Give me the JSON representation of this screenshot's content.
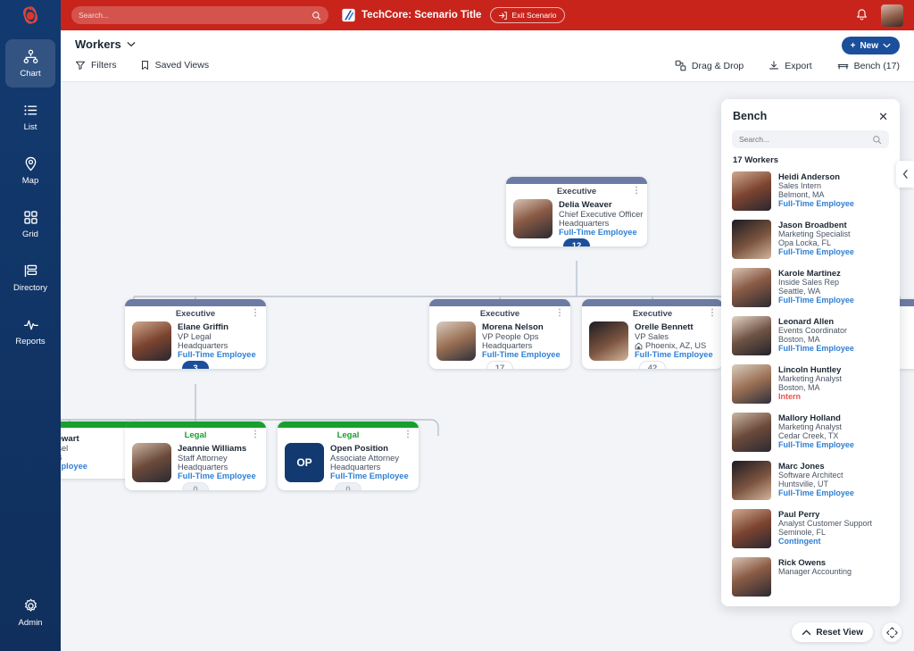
{
  "topbar": {
    "search_placeholder": "Search...",
    "scenario_title": "TechCore: Scenario Title",
    "exit_label": "Exit Scenario",
    "brand_color": "#c8241c"
  },
  "sidebar": {
    "items": [
      {
        "label": "Chart",
        "icon": "org-chart-icon",
        "active": true
      },
      {
        "label": "List",
        "icon": "list-icon",
        "active": false
      },
      {
        "label": "Map",
        "icon": "map-pin-icon",
        "active": false
      },
      {
        "label": "Grid",
        "icon": "grid-icon",
        "active": false
      },
      {
        "label": "Directory",
        "icon": "directory-icon",
        "active": false
      },
      {
        "label": "Reports",
        "icon": "pulse-icon",
        "active": false
      }
    ],
    "admin": {
      "label": "Admin",
      "icon": "gear-icon"
    }
  },
  "toolbar": {
    "title": "Workers",
    "filters_label": "Filters",
    "saved_views_label": "Saved Views",
    "drag_drop_label": "Drag & Drop",
    "export_label": "Export",
    "bench_label": "Bench (17)",
    "new_label": "New"
  },
  "chart": {
    "nodes": [
      {
        "name": "Delia Weaver",
        "role": "Chief Executive Officer",
        "location": "Headquarters",
        "type": "Full-Time Employee",
        "department": "Executive",
        "badge": "12",
        "badge_style": "blue",
        "has_home_icon": false,
        "avatar": "photo"
      },
      {
        "name": "Elane Griffin",
        "role": "VP Legal",
        "location": "Headquarters",
        "type": "Full-Time Employee",
        "department": "Executive",
        "badge": "3",
        "badge_style": "blue",
        "has_home_icon": false,
        "avatar": "photo"
      },
      {
        "name": "Morena Nelson",
        "role": "VP People Ops",
        "location": "Headquarters",
        "type": "Full-Time Employee",
        "department": "Executive",
        "badge": "17",
        "badge_style": "plain",
        "has_home_icon": false,
        "avatar": "photo"
      },
      {
        "name": "Orelle Bennett",
        "role": "VP Sales",
        "location": "Phoenix, AZ, US",
        "type": "Full-Time Employee",
        "department": "Executive",
        "badge": "42",
        "badge_style": "plain",
        "has_home_icon": true,
        "avatar": "photo"
      },
      {
        "name": "Stewart",
        "role": "unsel",
        "location": "ters",
        "type": "Employee",
        "department": "Legal",
        "badge": "",
        "badge_style": "none",
        "has_home_icon": false,
        "avatar": "none"
      },
      {
        "name": "Jeannie Williams",
        "role": "Staff Attorney",
        "location": "Headquarters",
        "type": "Full-Time Employee",
        "department": "Legal",
        "badge": "0",
        "badge_style": "zero",
        "has_home_icon": false,
        "avatar": "photo"
      },
      {
        "name": "Open Position",
        "role": "Associate Attorney",
        "location": "Headquarters",
        "type": "Full-Time Employee",
        "department": "Legal",
        "badge": "0",
        "badge_style": "zero",
        "has_home_icon": false,
        "avatar": "OP"
      }
    ]
  },
  "bench": {
    "title": "Bench",
    "search_placeholder": "Search...",
    "count_label": "17 Workers",
    "workers": [
      {
        "name": "Heidi Anderson",
        "role": "Sales Intern",
        "location": "Belmont, MA",
        "type": "Full-Time Employee"
      },
      {
        "name": "Jason Broadbent",
        "role": "Marketing Specialist",
        "location": "Opa Locka, FL",
        "type": "Full-Time Employee"
      },
      {
        "name": "Karole Martinez",
        "role": "Inside Sales Rep",
        "location": "Seattle, WA",
        "type": "Full-Time Employee"
      },
      {
        "name": "Leonard Allen",
        "role": "Events Coordinator",
        "location": "Boston, MA",
        "type": "Full-Time Employee"
      },
      {
        "name": "Lincoln Huntley",
        "role": "Marketing Analyst",
        "location": "Boston, MA",
        "type": "Intern"
      },
      {
        "name": "Mallory Holland",
        "role": "Marketing Analyst",
        "location": "Cedar Creek, TX",
        "type": "Full-Time Employee"
      },
      {
        "name": "Marc Jones",
        "role": "Software Architect",
        "location": "Huntsville, UT",
        "type": "Full-Time Employee"
      },
      {
        "name": "Paul Perry",
        "role": "Analyst Customer Support",
        "location": "Seminole, FL",
        "type": "Contingent"
      },
      {
        "name": "Rick Owens",
        "role": "Manager Accounting",
        "location": "",
        "type": ""
      }
    ]
  },
  "footer": {
    "reset_view_label": "Reset View"
  }
}
